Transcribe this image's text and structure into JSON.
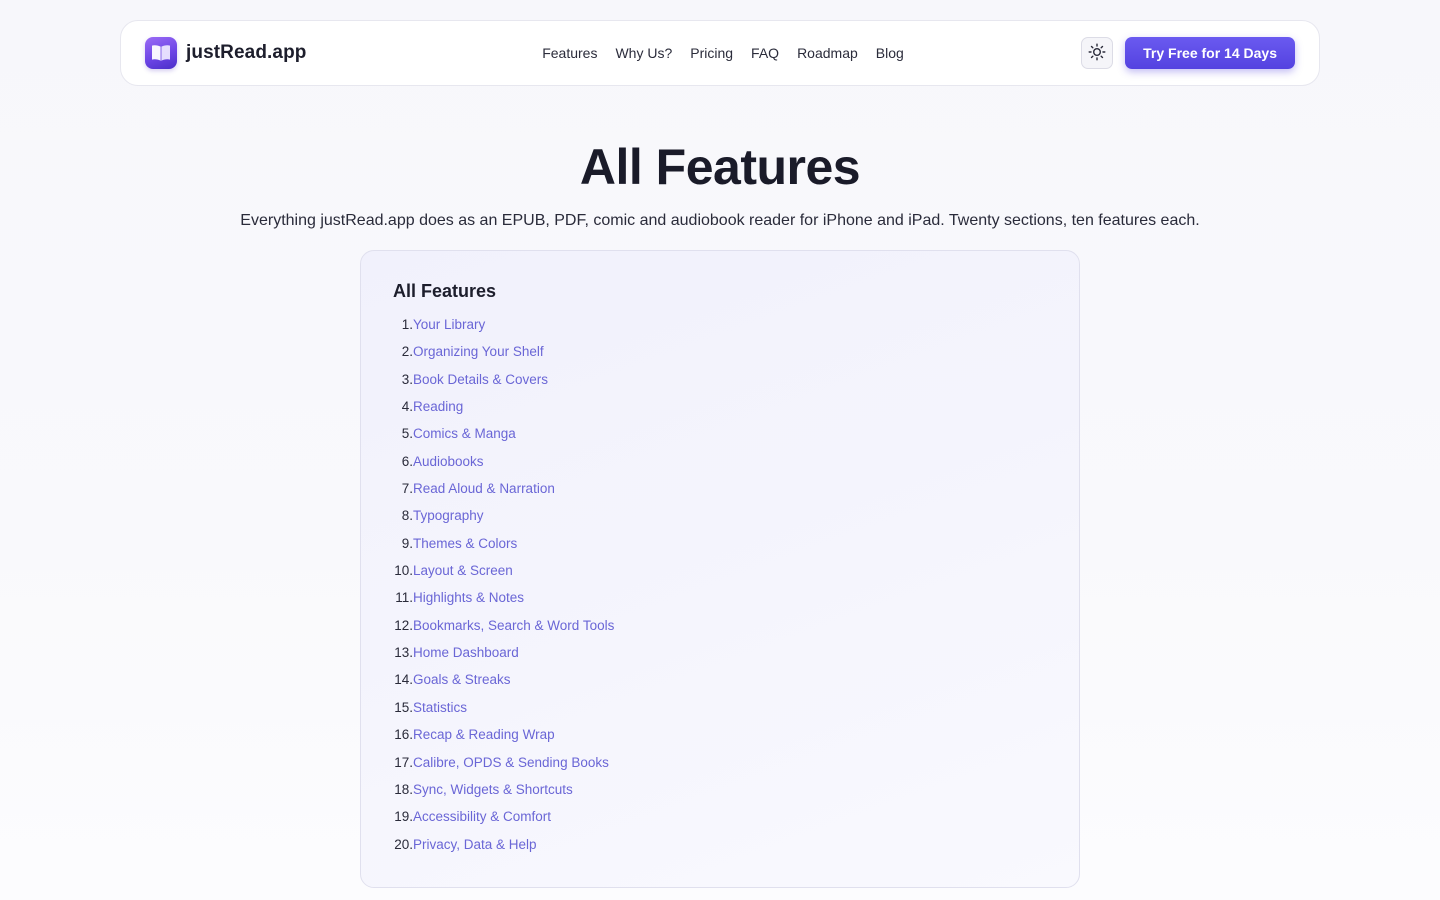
{
  "nav": {
    "brand": "justRead.app",
    "logo_icon": "open-book-icon",
    "links": [
      "Features",
      "Why Us?",
      "Pricing",
      "FAQ",
      "Roadmap",
      "Blog"
    ],
    "theme_icon": "sun-icon",
    "cta": "Try Free for 14 Days"
  },
  "hero": {
    "title": "All Features",
    "subtitle": "Everything justRead.app does as an EPUB, PDF, comic and audiobook reader for iPhone and iPad. Twenty sections, ten features each."
  },
  "toc": {
    "heading": "All Features",
    "items": [
      {
        "num": "1.",
        "label": "Your Library"
      },
      {
        "num": "2.",
        "label": "Organizing Your Shelf"
      },
      {
        "num": "3.",
        "label": "Book Details & Covers"
      },
      {
        "num": "4.",
        "label": "Reading"
      },
      {
        "num": "5.",
        "label": "Comics & Manga"
      },
      {
        "num": "6.",
        "label": "Audiobooks"
      },
      {
        "num": "7.",
        "label": "Read Aloud & Narration"
      },
      {
        "num": "8.",
        "label": "Typography"
      },
      {
        "num": "9.",
        "label": "Themes & Colors"
      },
      {
        "num": "10.",
        "label": "Layout & Screen"
      },
      {
        "num": "11.",
        "label": "Highlights & Notes"
      },
      {
        "num": "12.",
        "label": "Bookmarks, Search & Word Tools"
      },
      {
        "num": "13.",
        "label": "Home Dashboard"
      },
      {
        "num": "14.",
        "label": "Goals & Streaks"
      },
      {
        "num": "15.",
        "label": "Statistics"
      },
      {
        "num": "16.",
        "label": "Recap & Reading Wrap"
      },
      {
        "num": "17.",
        "label": "Calibre, OPDS & Sending Books"
      },
      {
        "num": "18.",
        "label": "Sync, Widgets & Shortcuts"
      },
      {
        "num": "19.",
        "label": "Accessibility & Comfort"
      },
      {
        "num": "20.",
        "label": "Privacy, Data & Help"
      }
    ]
  },
  "colors": {
    "accent": "#5a48e6",
    "link": "#6a66d6",
    "text": "#1f2030"
  }
}
